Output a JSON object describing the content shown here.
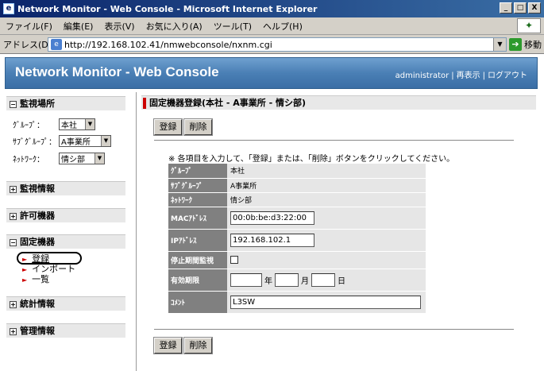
{
  "window": {
    "title": "Network Monitor - Web Console - Microsoft Internet Explorer",
    "controls": [
      "_",
      "□",
      "X"
    ]
  },
  "menubar": [
    "ファイル(F)",
    "編集(E)",
    "表示(V)",
    "お気に入り(A)",
    "ツール(T)",
    "ヘルプ(H)"
  ],
  "address": {
    "label": "アドレス(D)",
    "url": "http://192.168.102.41/nmwebconsole/nxnm.cgi",
    "go_label": "移動"
  },
  "banner": {
    "title": "Network Monitor - Web Console",
    "links": [
      "administrator",
      "再表示",
      "ログアウト"
    ],
    "separator": "|"
  },
  "sidebar": {
    "monitor_location": {
      "title": "監視場所",
      "toggle": "−",
      "fields": [
        {
          "label": "ｸﾞﾙｰﾌﾟ：",
          "value": "本社"
        },
        {
          "label": "ｻﾌﾞｸﾞﾙｰﾌﾟ：",
          "value": "A事業所"
        },
        {
          "label": "ﾈｯﾄﾜｰｸ：",
          "value": "情シ部"
        }
      ]
    },
    "sections": [
      {
        "title": "監視情報",
        "toggle": "+"
      },
      {
        "title": "許可機器",
        "toggle": "+"
      },
      {
        "title": "固定機器",
        "toggle": "−"
      },
      {
        "title": "統計情報",
        "toggle": "+"
      },
      {
        "title": "管理情報",
        "toggle": "+"
      }
    ],
    "fixed_device_links": [
      "登録",
      "インポート",
      "一覧"
    ],
    "link_marker": "►"
  },
  "main": {
    "header": "固定機器登録(本社 - A事業所 - 情シ部)",
    "buttons": {
      "register": "登録",
      "delete": "削除"
    },
    "instruction": "※ 各項目を入力して、「登録」または、「削除」ボタンをクリックしてください。",
    "rows": {
      "group": {
        "label": "ｸﾞﾙｰﾌﾟ",
        "value": "本社"
      },
      "subgroup": {
        "label": "ｻﾌﾞｸﾞﾙｰﾌﾟ",
        "value": "A事業所"
      },
      "network": {
        "label": "ﾈｯﾄﾜｰｸ",
        "value": "情シ部"
      },
      "mac": {
        "label": "MACｱﾄﾞﾚｽ",
        "value": "00:0b:be:d3:22:00"
      },
      "ip": {
        "label": "IPｱﾄﾞﾚｽ",
        "value": "192.168.102.1"
      },
      "stop_monitor": {
        "label": "停止期間監視",
        "checked": false
      },
      "expiry": {
        "label": "有効期限",
        "year_unit": "年",
        "month_unit": "月",
        "day_unit": "日",
        "year": "",
        "month": "",
        "day": ""
      },
      "comment": {
        "label": "ｺﾒﾝﾄ",
        "value": "L3SW"
      }
    }
  }
}
